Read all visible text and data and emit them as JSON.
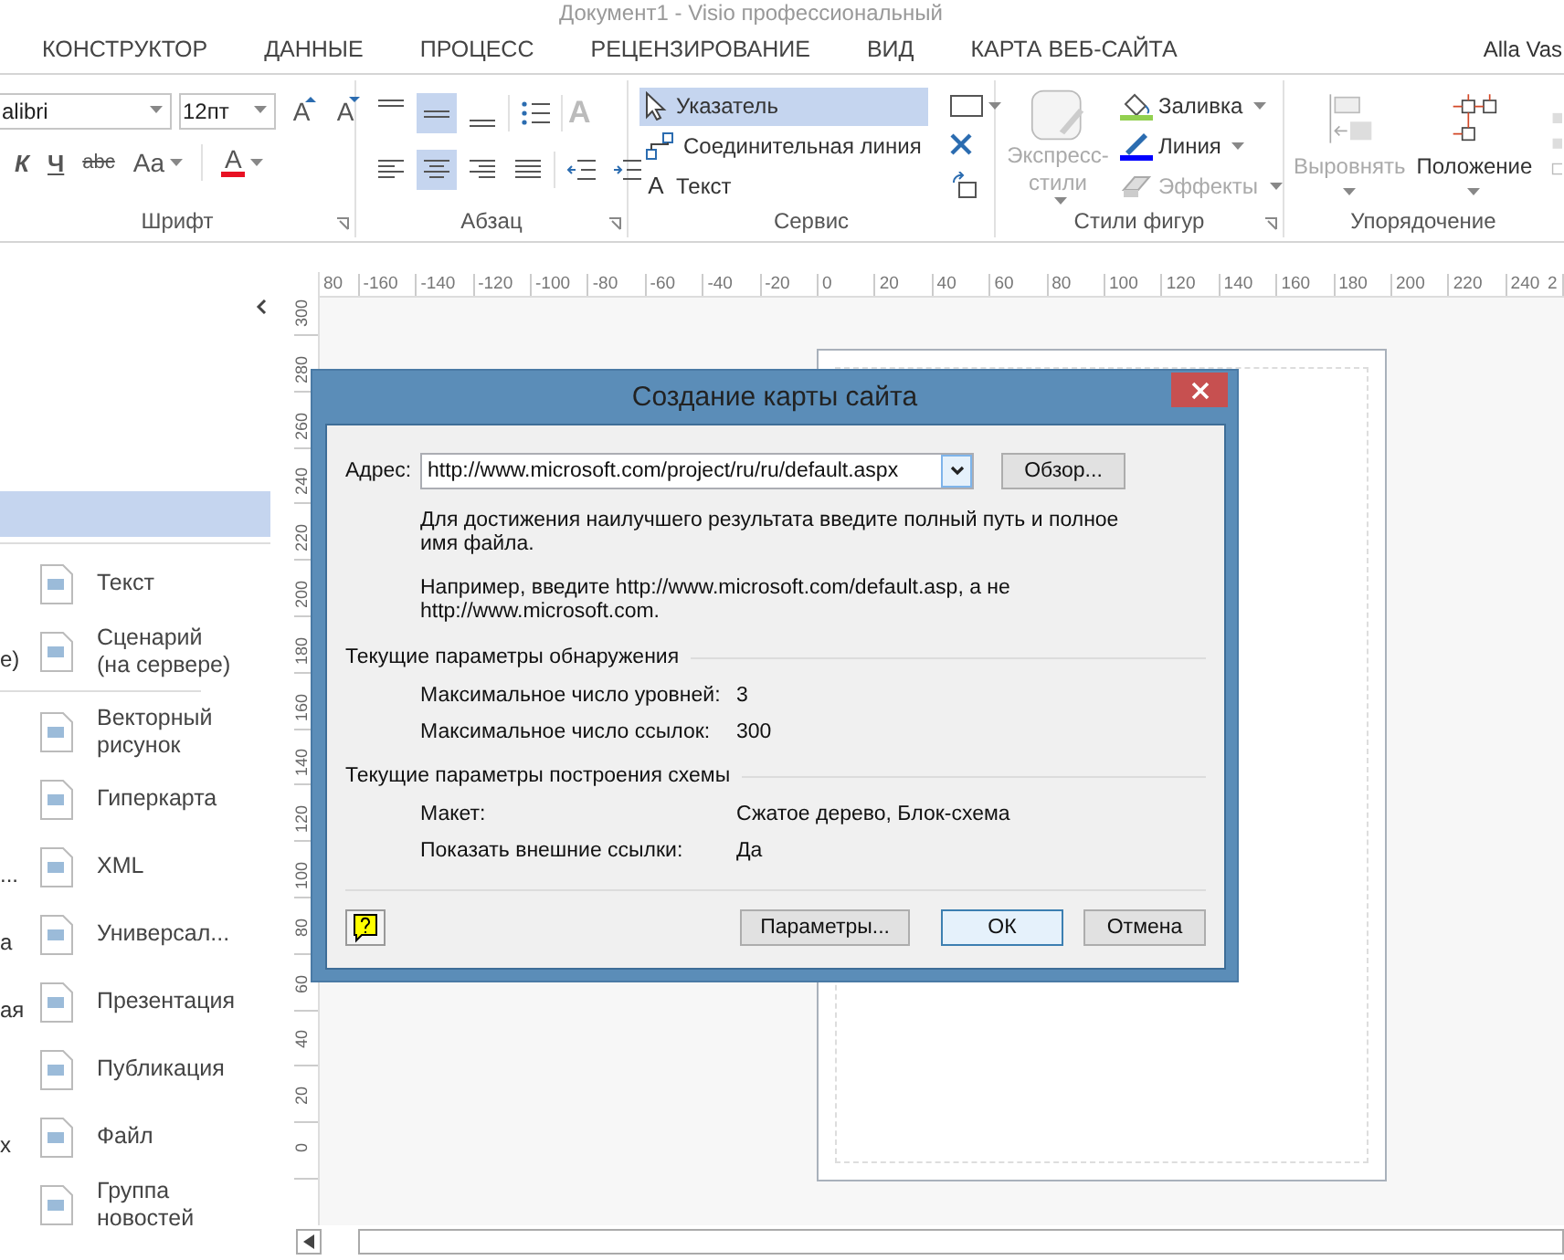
{
  "title_bar": {
    "title": "Документ1 -  Visio профессиональный"
  },
  "tabs": [
    {
      "label": "КОНСТРУКТОР",
      "selected": false
    },
    {
      "label": "ДАННЫЕ",
      "selected": false
    },
    {
      "label": "ПРОЦЕСС",
      "selected": false
    },
    {
      "label": "РЕЦЕНЗИРОВАНИЕ",
      "selected": false
    },
    {
      "label": "ВИД",
      "selected": false
    },
    {
      "label": "КАРТА ВЕБ-САЙТА",
      "selected": false
    }
  ],
  "user": {
    "name": "Alla Vas"
  },
  "font_group": {
    "label": "Шрифт",
    "font_name": "alibri",
    "font_size": "12пт",
    "size_buttons": [
      {
        "label": "A",
        "kind": "grow"
      },
      {
        "label": "A",
        "kind": "shrink"
      }
    ],
    "format_buttons": [
      {
        "label": "К",
        "kind": "italic"
      },
      {
        "label": "Ч",
        "kind": "underline"
      },
      {
        "label": "abc",
        "kind": "strike"
      },
      {
        "label": "Aa",
        "kind": "case"
      }
    ],
    "font_color": {
      "label": "A",
      "color": "#e81123"
    }
  },
  "paragraph_group": {
    "label": "Абзац",
    "vertical_align": [
      {
        "kind": "top",
        "selected": false
      },
      {
        "kind": "middle",
        "selected": true
      },
      {
        "kind": "bottom",
        "selected": false
      }
    ],
    "text_direction": {
      "label": "A",
      "disabled": true
    },
    "horizontal_align": [
      {
        "kind": "left",
        "selected": false
      },
      {
        "kind": "center",
        "selected": true
      },
      {
        "kind": "right",
        "selected": false
      },
      {
        "kind": "justify",
        "selected": false
      }
    ]
  },
  "tools_group": {
    "label": "Сервис",
    "tools": [
      {
        "kind": "pointer",
        "label": "Указатель",
        "selected": true
      },
      {
        "kind": "connector",
        "label": "Соединительная линия",
        "selected": false
      },
      {
        "kind": "text",
        "icon_label": "A",
        "label": "Текст",
        "selected": false
      }
    ]
  },
  "styles_group": {
    "label": "Стили фигур",
    "quick_styles": {
      "label": "Экспресс-стили",
      "disabled": true
    },
    "items": [
      {
        "kind": "fill",
        "label": "Заливка",
        "disabled": false,
        "color": "#92d050"
      },
      {
        "kind": "line",
        "label": "Линия",
        "disabled": false,
        "color": "#0000ff"
      },
      {
        "kind": "effects",
        "label": "Эффекты",
        "disabled": true
      }
    ]
  },
  "arrange_group": {
    "label": "Упорядочение",
    "buttons": [
      {
        "kind": "align",
        "label": "Выровнять",
        "disabled": true
      },
      {
        "kind": "position",
        "label": "Положение",
        "disabled": false
      }
    ]
  },
  "left_panel": {
    "highlighted_row": true,
    "sections": [
      [
        {
          "label": "Текст"
        },
        {
          "label": "Сценарий (на сервере)",
          "cut_text": "е)"
        }
      ],
      [
        {
          "label": "Векторный рисунок"
        },
        {
          "label": "Гиперкарта"
        },
        {
          "label": "XML",
          "cut_text": "..."
        },
        {
          "label": "Универсал...",
          "cut_text": "а"
        },
        {
          "label": "Презентация",
          "cut_text": "ая"
        },
        {
          "label": "Публикация"
        },
        {
          "label": "Файл",
          "cut_text": "х"
        },
        {
          "label": "Группа новостей"
        }
      ]
    ]
  },
  "horizontal_ruler": [
    "80",
    "-160",
    "-140",
    "-120",
    "-100",
    "-80",
    "-60",
    "-40",
    "-20",
    "0",
    "20",
    "40",
    "60",
    "80",
    "100",
    "120",
    "140",
    "160",
    "180",
    "200",
    "220",
    "240",
    "2"
  ],
  "vertical_ruler": [
    "300",
    "280",
    "260",
    "240",
    "220",
    "200",
    "180",
    "160",
    "140",
    "120",
    "100",
    "80",
    "60",
    "40",
    "20",
    "0"
  ],
  "dialog": {
    "title": "Создание карты сайта",
    "address_label": "Адрес:",
    "address": "http://www.microsoft.com/project/ru/ru/default.aspx",
    "browse": "Обзор...",
    "hints": [
      "Для достижения наилучшего результата введите полный путь и полное имя файла.",
      "Например, введите http://www.microsoft.com/default.asp, а не http://www.microsoft.com."
    ],
    "sections": [
      {
        "title": "Текущие параметры обнаружения",
        "rows": [
          {
            "label": "Максимальное число уровней:",
            "value": "3"
          },
          {
            "label": "Максимальное число ссылок:",
            "value": "300"
          }
        ]
      },
      {
        "title": "Текущие параметры построения схемы",
        "rows": [
          {
            "label": "Макет:",
            "value": "Сжатое дерево, Блок-схема"
          },
          {
            "label": "Показать внешние ссылки:",
            "value": "Да"
          }
        ]
      }
    ],
    "buttons": [
      {
        "label": "Параметры...",
        "default": false
      },
      {
        "label": "ОК",
        "default": true
      },
      {
        "label": "Отмена",
        "default": false
      }
    ]
  }
}
